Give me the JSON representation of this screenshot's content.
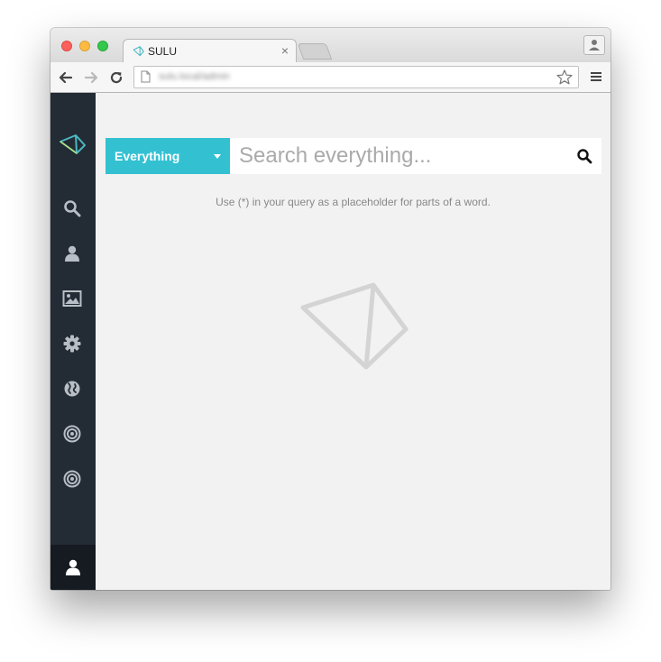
{
  "browser": {
    "tab": {
      "title": "SULU",
      "close_glyph": "×",
      "favicon": "sulu-logo-icon"
    },
    "toolbar": {
      "url": "sulu.local/admin"
    }
  },
  "sidebar": {
    "logo": "sulu-logo-icon",
    "items": [
      {
        "icon": "search-icon"
      },
      {
        "icon": "user-icon"
      },
      {
        "icon": "image-icon"
      },
      {
        "icon": "gear-icon"
      },
      {
        "icon": "globe-icon"
      },
      {
        "icon": "target-icon"
      },
      {
        "icon": "target-icon"
      }
    ],
    "footer": {
      "icon": "user-icon"
    }
  },
  "search": {
    "category_label": "Everything",
    "placeholder": "Search everything...",
    "value": "",
    "hint": "Use (*) in your query as a placeholder for parts of a word."
  },
  "colors": {
    "accent": "#33c1d2",
    "sidebar_bg": "#232b34",
    "sidebar_active_bg": "#161b21",
    "content_bg": "#f2f2f2"
  }
}
